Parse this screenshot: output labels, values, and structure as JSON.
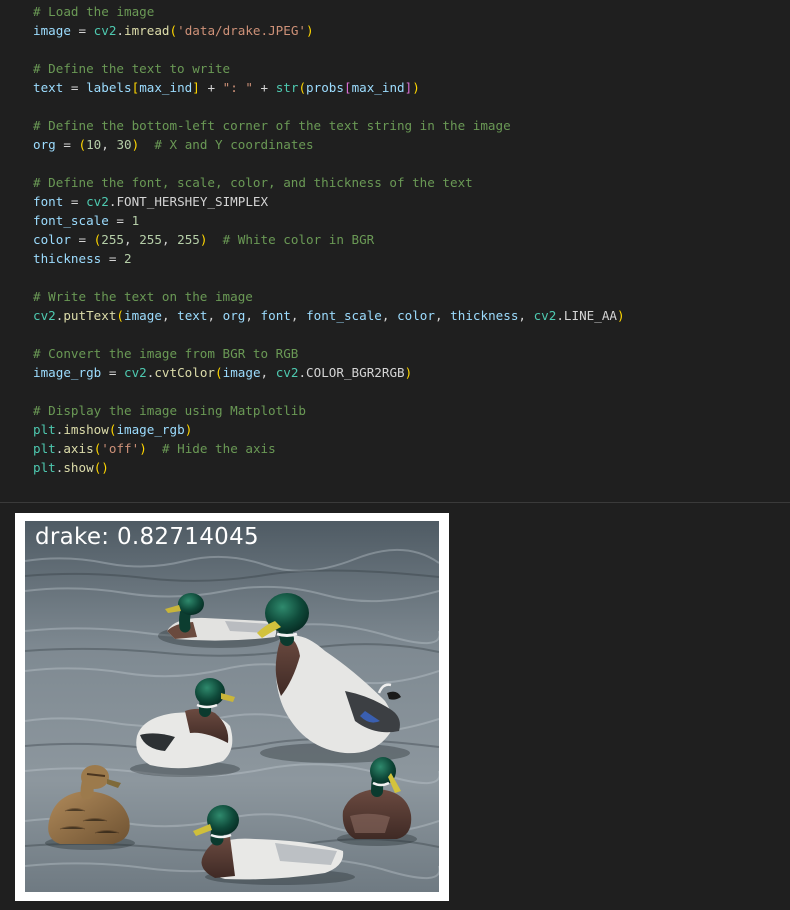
{
  "code_cell": {
    "lines": [
      [
        {
          "t": "# Load the image",
          "c": "comment"
        }
      ],
      [
        {
          "t": "image",
          "c": "var"
        },
        {
          "t": " = ",
          "c": "op"
        },
        {
          "t": "cv2",
          "c": "mod"
        },
        {
          "t": ".",
          "c": "op"
        },
        {
          "t": "imread",
          "c": "func"
        },
        {
          "t": "(",
          "c": "b1"
        },
        {
          "t": "'data/drake.JPEG'",
          "c": "str"
        },
        {
          "t": ")",
          "c": "b1"
        }
      ],
      [],
      [
        {
          "t": "# Define the text to write",
          "c": "comment"
        }
      ],
      [
        {
          "t": "text",
          "c": "var"
        },
        {
          "t": " = ",
          "c": "op"
        },
        {
          "t": "labels",
          "c": "var"
        },
        {
          "t": "[",
          "c": "b1"
        },
        {
          "t": "max_ind",
          "c": "var"
        },
        {
          "t": "]",
          "c": "b1"
        },
        {
          "t": " + ",
          "c": "op"
        },
        {
          "t": "\": \"",
          "c": "str"
        },
        {
          "t": " + ",
          "c": "op"
        },
        {
          "t": "str",
          "c": "mod"
        },
        {
          "t": "(",
          "c": "b1"
        },
        {
          "t": "probs",
          "c": "var"
        },
        {
          "t": "[",
          "c": "b2"
        },
        {
          "t": "max_ind",
          "c": "var"
        },
        {
          "t": "]",
          "c": "b2"
        },
        {
          "t": ")",
          "c": "b1"
        }
      ],
      [],
      [
        {
          "t": "# Define the bottom-left corner of the text string in the image",
          "c": "comment"
        }
      ],
      [
        {
          "t": "org",
          "c": "var"
        },
        {
          "t": " = ",
          "c": "op"
        },
        {
          "t": "(",
          "c": "b1"
        },
        {
          "t": "10",
          "c": "num"
        },
        {
          "t": ", ",
          "c": "op"
        },
        {
          "t": "30",
          "c": "num"
        },
        {
          "t": ")",
          "c": "b1"
        },
        {
          "t": "  ",
          "c": "op"
        },
        {
          "t": "# X and Y coordinates",
          "c": "comment"
        }
      ],
      [],
      [
        {
          "t": "# Define the font, scale, color, and thickness of the text",
          "c": "comment"
        }
      ],
      [
        {
          "t": "font",
          "c": "var"
        },
        {
          "t": " = ",
          "c": "op"
        },
        {
          "t": "cv2",
          "c": "mod"
        },
        {
          "t": ".",
          "c": "op"
        },
        {
          "t": "FONT_HERSHEY_SIMPLEX",
          "c": "op"
        }
      ],
      [
        {
          "t": "font_scale",
          "c": "var"
        },
        {
          "t": " = ",
          "c": "op"
        },
        {
          "t": "1",
          "c": "num"
        }
      ],
      [
        {
          "t": "color",
          "c": "var"
        },
        {
          "t": " = ",
          "c": "op"
        },
        {
          "t": "(",
          "c": "b1"
        },
        {
          "t": "255",
          "c": "num"
        },
        {
          "t": ", ",
          "c": "op"
        },
        {
          "t": "255",
          "c": "num"
        },
        {
          "t": ", ",
          "c": "op"
        },
        {
          "t": "255",
          "c": "num"
        },
        {
          "t": ")",
          "c": "b1"
        },
        {
          "t": "  ",
          "c": "op"
        },
        {
          "t": "# White color in BGR",
          "c": "comment"
        }
      ],
      [
        {
          "t": "thickness",
          "c": "var"
        },
        {
          "t": " = ",
          "c": "op"
        },
        {
          "t": "2",
          "c": "num"
        }
      ],
      [],
      [
        {
          "t": "# Write the text on the image",
          "c": "comment"
        }
      ],
      [
        {
          "t": "cv2",
          "c": "mod"
        },
        {
          "t": ".",
          "c": "op"
        },
        {
          "t": "putText",
          "c": "func"
        },
        {
          "t": "(",
          "c": "b1"
        },
        {
          "t": "image",
          "c": "var"
        },
        {
          "t": ", ",
          "c": "op"
        },
        {
          "t": "text",
          "c": "var"
        },
        {
          "t": ", ",
          "c": "op"
        },
        {
          "t": "org",
          "c": "var"
        },
        {
          "t": ", ",
          "c": "op"
        },
        {
          "t": "font",
          "c": "var"
        },
        {
          "t": ", ",
          "c": "op"
        },
        {
          "t": "font_scale",
          "c": "var"
        },
        {
          "t": ", ",
          "c": "op"
        },
        {
          "t": "color",
          "c": "var"
        },
        {
          "t": ", ",
          "c": "op"
        },
        {
          "t": "thickness",
          "c": "var"
        },
        {
          "t": ", ",
          "c": "op"
        },
        {
          "t": "cv2",
          "c": "mod"
        },
        {
          "t": ".",
          "c": "op"
        },
        {
          "t": "LINE_AA",
          "c": "op"
        },
        {
          "t": ")",
          "c": "b1"
        }
      ],
      [],
      [
        {
          "t": "# Convert the image from BGR to RGB",
          "c": "comment"
        }
      ],
      [
        {
          "t": "image_rgb",
          "c": "var"
        },
        {
          "t": " = ",
          "c": "op"
        },
        {
          "t": "cv2",
          "c": "mod"
        },
        {
          "t": ".",
          "c": "op"
        },
        {
          "t": "cvtColor",
          "c": "func"
        },
        {
          "t": "(",
          "c": "b1"
        },
        {
          "t": "image",
          "c": "var"
        },
        {
          "t": ", ",
          "c": "op"
        },
        {
          "t": "cv2",
          "c": "mod"
        },
        {
          "t": ".",
          "c": "op"
        },
        {
          "t": "COLOR_BGR2RGB",
          "c": "op"
        },
        {
          "t": ")",
          "c": "b1"
        }
      ],
      [],
      [
        {
          "t": "# Display the image using Matplotlib",
          "c": "comment"
        }
      ],
      [
        {
          "t": "plt",
          "c": "mod"
        },
        {
          "t": ".",
          "c": "op"
        },
        {
          "t": "imshow",
          "c": "func"
        },
        {
          "t": "(",
          "c": "b1"
        },
        {
          "t": "image_rgb",
          "c": "var"
        },
        {
          "t": ")",
          "c": "b1"
        }
      ],
      [
        {
          "t": "plt",
          "c": "mod"
        },
        {
          "t": ".",
          "c": "op"
        },
        {
          "t": "axis",
          "c": "func"
        },
        {
          "t": "(",
          "c": "b1"
        },
        {
          "t": "'off'",
          "c": "str"
        },
        {
          "t": ")",
          "c": "b1"
        },
        {
          "t": "  ",
          "c": "op"
        },
        {
          "t": "# Hide the axis",
          "c": "comment"
        }
      ],
      [
        {
          "t": "plt",
          "c": "mod"
        },
        {
          "t": ".",
          "c": "op"
        },
        {
          "t": "show",
          "c": "func"
        },
        {
          "t": "(",
          "c": "b1"
        },
        {
          "t": ")",
          "c": "b1"
        }
      ]
    ]
  },
  "output": {
    "overlay_text": "drake: 0.82714045",
    "image_subject": "mallard-ducks-on-water"
  },
  "colors": {
    "background": "#1f1f1f",
    "comment": "#6a9955",
    "variable": "#9cdcfe",
    "module": "#4ec9b0",
    "function": "#dcdcaa",
    "string": "#ce9178",
    "number": "#b5cea8",
    "bracket_1": "#ffd700",
    "bracket_2": "#da70d6"
  }
}
